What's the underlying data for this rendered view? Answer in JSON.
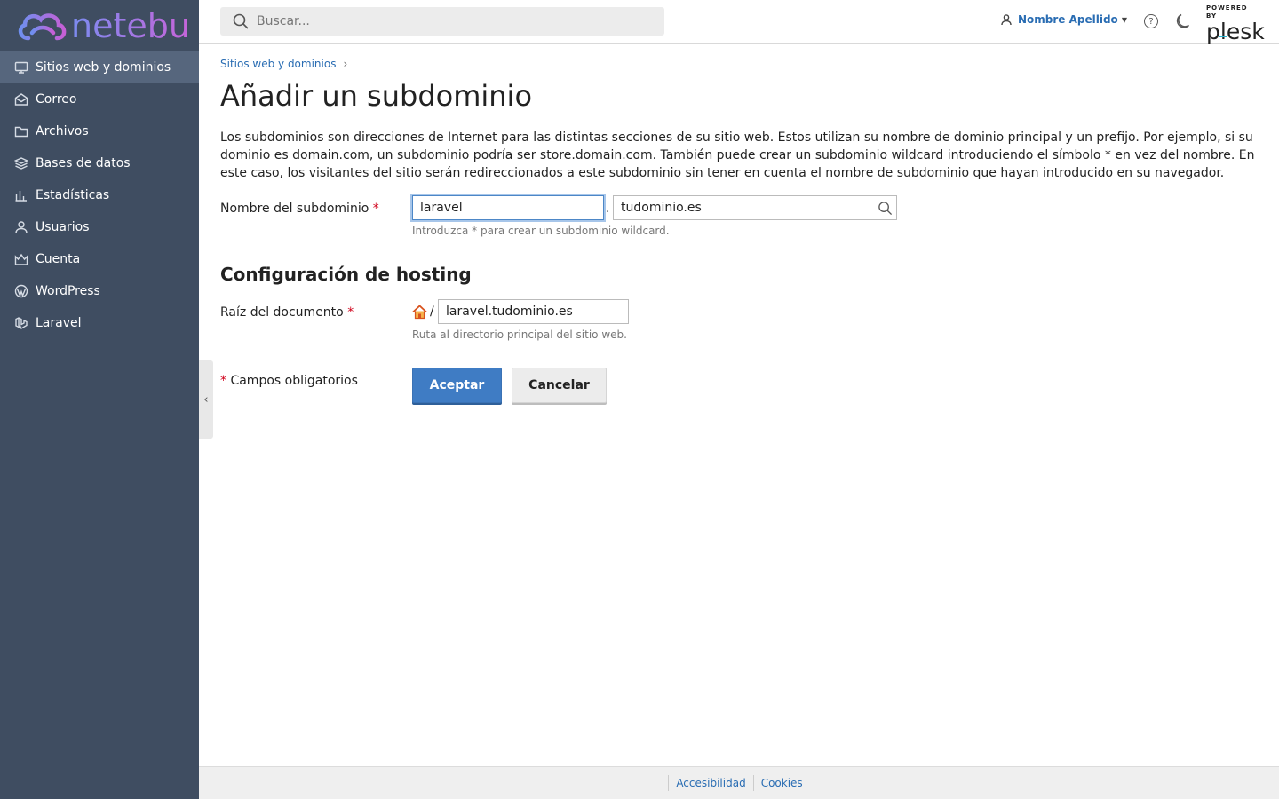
{
  "brand": {
    "name": "netebu"
  },
  "sidebar": {
    "items": [
      {
        "label": "Sitios web y dominios",
        "icon": "monitor-icon",
        "active": true
      },
      {
        "label": "Correo",
        "icon": "mail-icon"
      },
      {
        "label": "Archivos",
        "icon": "folder-icon"
      },
      {
        "label": "Bases de datos",
        "icon": "database-icon"
      },
      {
        "label": "Estadísticas",
        "icon": "bar-chart-icon"
      },
      {
        "label": "Usuarios",
        "icon": "user-icon"
      },
      {
        "label": "Cuenta",
        "icon": "crown-icon"
      },
      {
        "label": "WordPress",
        "icon": "wordpress-icon"
      },
      {
        "label": "Laravel",
        "icon": "laravel-icon"
      }
    ]
  },
  "topbar": {
    "search_placeholder": "Buscar...",
    "user_name": "Nombre Apellido",
    "help_symbol": "?",
    "powered_by": "POWERED BY",
    "plesk_logo": "plesk"
  },
  "breadcrumb": {
    "item": "Sitios web y dominios"
  },
  "page": {
    "title": "Añadir un subdominio",
    "intro": "Los subdominios son direcciones de Internet para las distintas secciones de su sitio web. Estos utilizan su nombre de dominio principal y un prefijo. Por ejemplo, si su dominio es domain.com, un subdominio podría ser store.domain.com. También puede crear un subdominio wildcard introduciendo el símbolo * en vez del nombre. En este caso, los visitantes del sitio serán redireccionados a este subdominio sin tener en cuenta el nombre de subdominio que hayan introducido en su navegador."
  },
  "form": {
    "subdomain_label": "Nombre del subdominio",
    "required_mark": "*",
    "subdomain_value": "laravel",
    "dot": ".",
    "domain_value": "tudominio.es",
    "subdomain_hint": "Introduzca * para crear un subdominio wildcard.",
    "hosting_section": "Configuración de hosting",
    "docroot_label": "Raíz del documento",
    "docroot_prefix": "/",
    "docroot_value": "laravel.tudominio.es",
    "docroot_hint": "Ruta al directorio principal del sitio web.",
    "required_note": "Campos obligatorios",
    "ok_label": "Aceptar",
    "cancel_label": "Cancelar"
  },
  "footer": {
    "links": [
      "Accesibilidad",
      "Cookies"
    ]
  },
  "colors": {
    "sidebar_bg": "#3f4d61",
    "sidebar_active": "#56667d",
    "link": "#2a6db3",
    "primary_button": "#3f7cc4",
    "required": "#d0021b"
  }
}
